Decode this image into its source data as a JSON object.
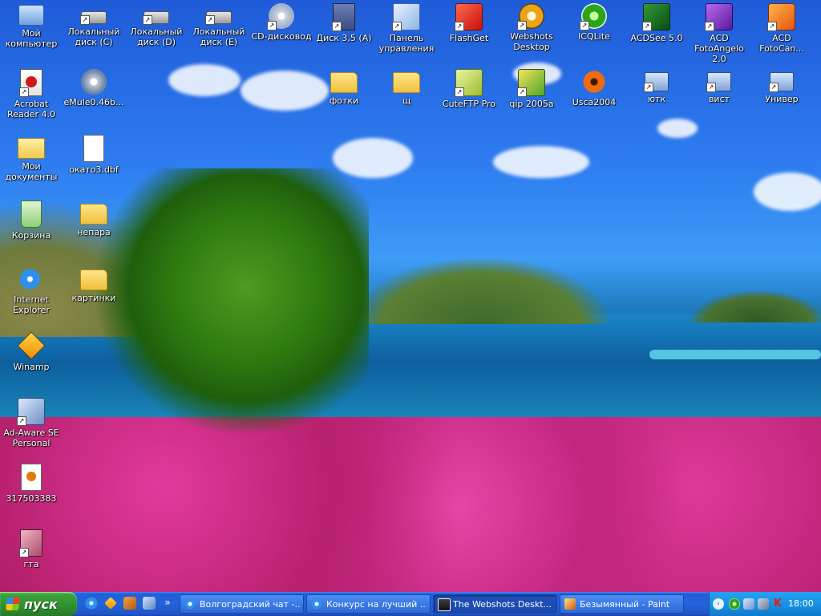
{
  "desktop": {
    "icons": [
      {
        "label": "Мой компьютер",
        "icon": "computer-icon"
      },
      {
        "label": "Локальный диск (C)",
        "icon": "drive-icon"
      },
      {
        "label": "Локальный диск (D)",
        "icon": "drive-icon"
      },
      {
        "label": "Локальный диск (E)",
        "icon": "drive-icon"
      },
      {
        "label": "CD-дисковод",
        "icon": "cd-drive-icon"
      },
      {
        "label": "Диск 3,5 (A)",
        "icon": "floppy-icon"
      },
      {
        "label": "Панель управления",
        "icon": "control-panel-icon"
      },
      {
        "label": "FlashGet",
        "icon": "flashget-icon"
      },
      {
        "label": "Webshots Desktop",
        "icon": "webshots-icon"
      },
      {
        "label": "ICQLite",
        "icon": "icq-icon"
      },
      {
        "label": "ACDSee 5.0",
        "icon": "acdsee-icon"
      },
      {
        "label": "ACD FotoAngelo 2.0",
        "icon": "fotoangelo-icon"
      },
      {
        "label": "ACD FotoCan...",
        "icon": "fotocanvas-icon"
      },
      {
        "label": "Acrobat Reader 4.0",
        "icon": "acrobat-icon"
      },
      {
        "label": "eMule0.46b...",
        "icon": "emule-icon"
      },
      {
        "label": "фотки",
        "icon": "folder-icon"
      },
      {
        "label": "щ",
        "icon": "folder-icon"
      },
      {
        "label": "CuteFTP Pro",
        "icon": "cuteftp-icon"
      },
      {
        "label": "qip 2005a",
        "icon": "qip-icon"
      },
      {
        "label": "Usca2004",
        "icon": "usca-icon"
      },
      {
        "label": "ютк",
        "icon": "network-icon"
      },
      {
        "label": "вист",
        "icon": "network-icon"
      },
      {
        "label": "Универ",
        "icon": "network-icon"
      },
      {
        "label": "Мои документы",
        "icon": "my-documents-icon"
      },
      {
        "label": "окато3.dbf",
        "icon": "file-icon"
      },
      {
        "label": "Корзина",
        "icon": "recycle-bin-icon"
      },
      {
        "label": "непара",
        "icon": "folder-icon"
      },
      {
        "label": "Internet Explorer",
        "icon": "internet-explorer-icon"
      },
      {
        "label": "картинки",
        "icon": "folder-icon"
      },
      {
        "label": "Winamp",
        "icon": "winamp-icon"
      },
      {
        "label": "Ad-Aware SE Personal",
        "icon": "adaware-icon"
      },
      {
        "label": "317503383",
        "icon": "image-file-icon"
      },
      {
        "label": "гта",
        "icon": "gta-icon"
      }
    ]
  },
  "taskbar": {
    "start_label": "пуск",
    "quick_launch": [
      "internet-explorer-icon",
      "winamp-icon",
      "app-icon",
      "network-icon"
    ],
    "tasks": [
      {
        "label": "Волгоградский чат -...",
        "icon": "internet-explorer-icon",
        "active": false
      },
      {
        "label": "Конкурс на лучший ...",
        "icon": "internet-explorer-icon",
        "active": false
      },
      {
        "label": "The Webshots Deskt...",
        "icon": "camera-icon",
        "active": true
      },
      {
        "label": "Безымянный - Paint",
        "icon": "paint-icon",
        "active": false
      }
    ],
    "language": "RL",
    "clock": "18:00"
  },
  "colors": {
    "taskbar_blue": "#245edb",
    "start_green": "#3aa13a",
    "tray_blue": "#1892e3"
  }
}
